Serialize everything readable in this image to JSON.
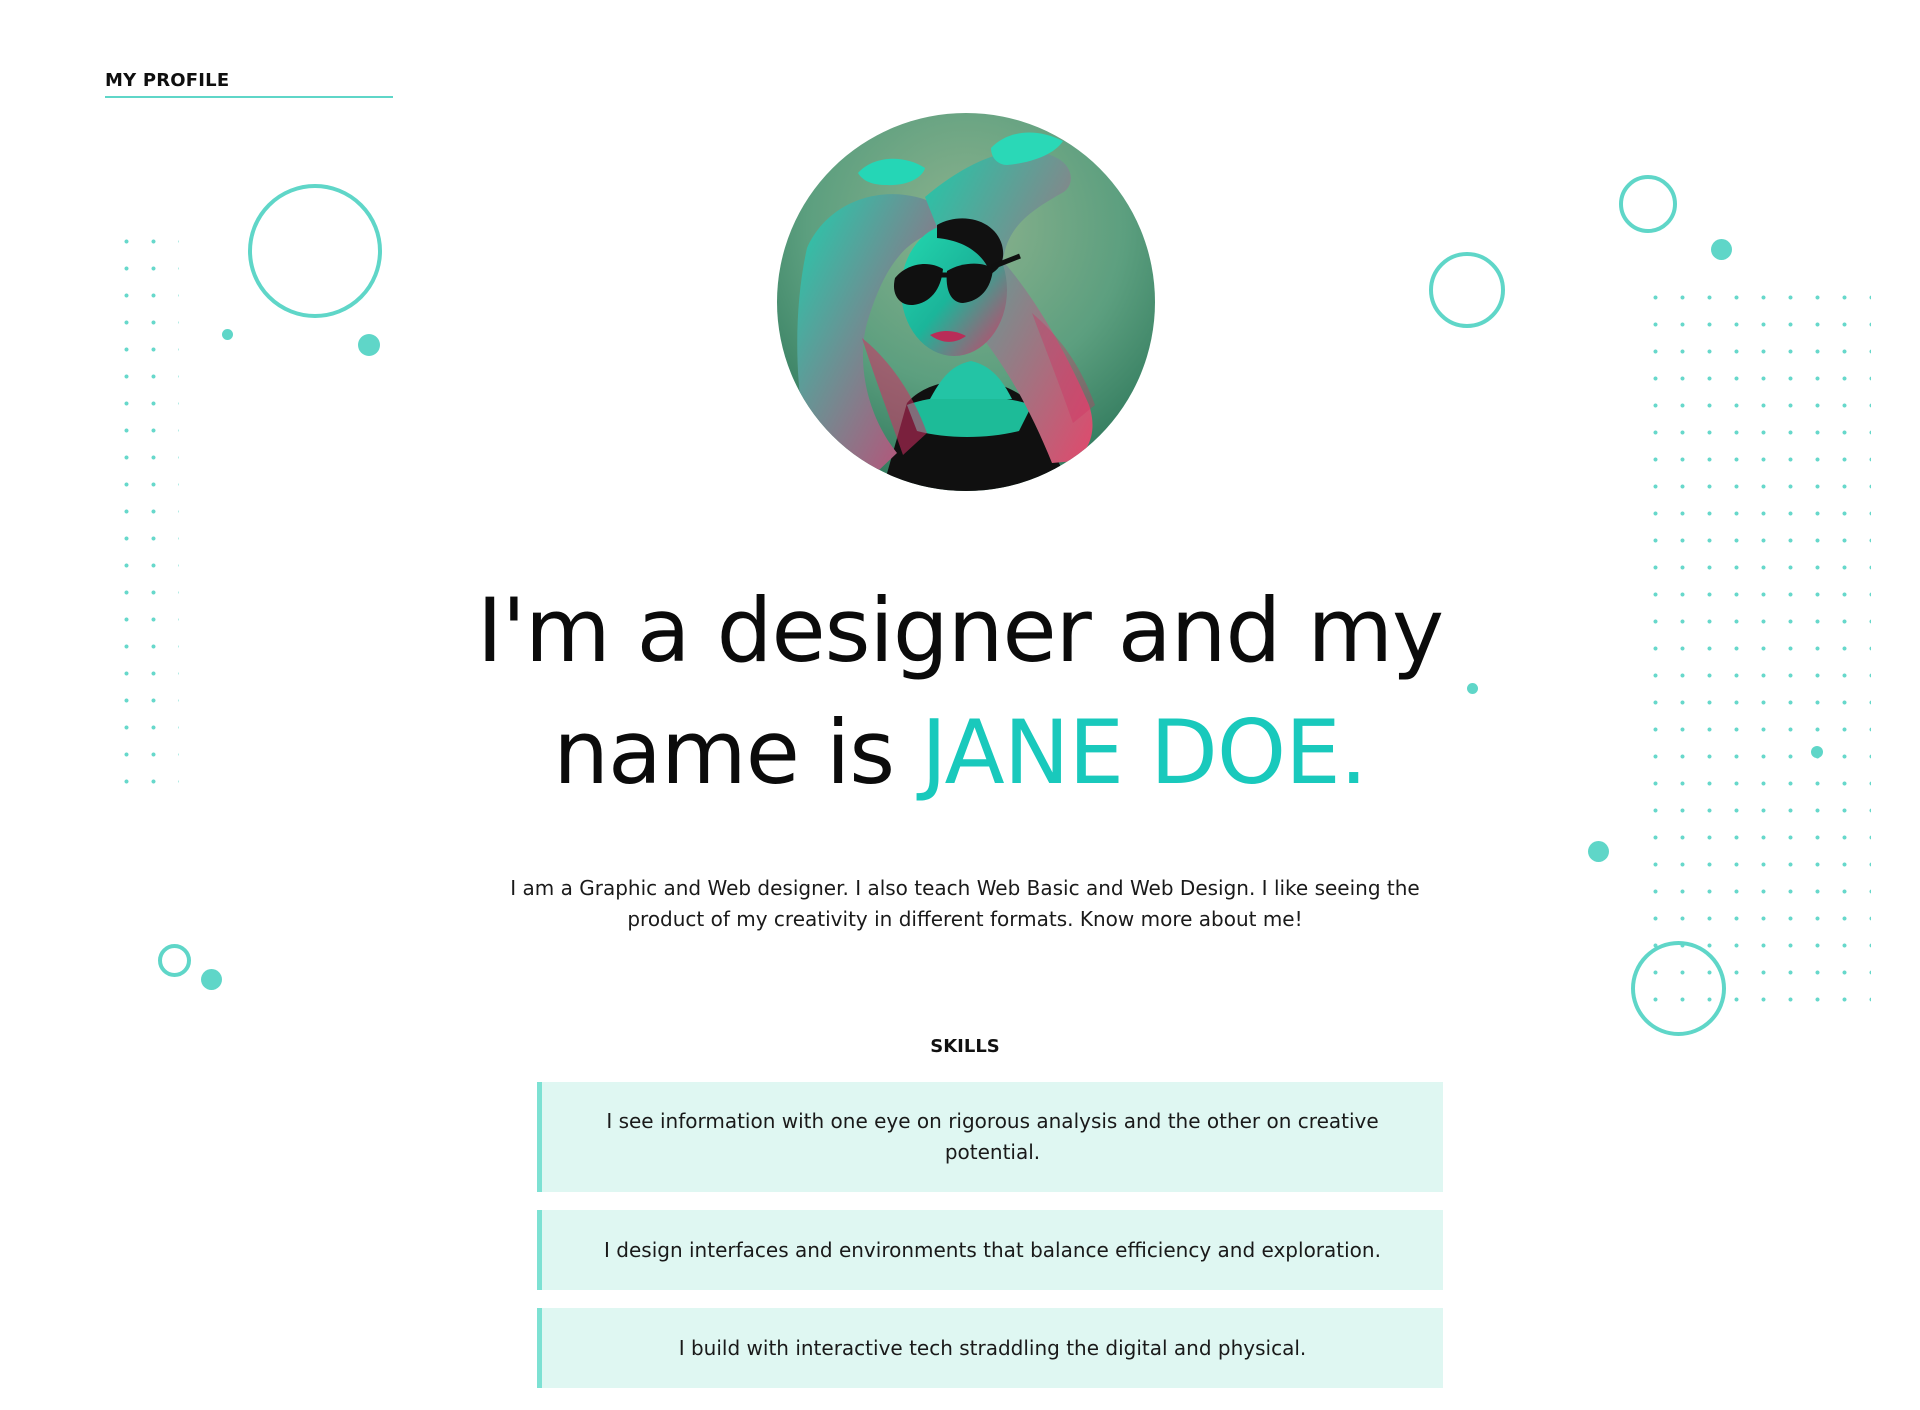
{
  "header": {
    "title": "MY PROFILE"
  },
  "hero": {
    "avatar_label": "profile-photo",
    "headline_line1": "I'm a designer and my",
    "headline_prefix": "name is ",
    "headline_name": "JANE DOE.",
    "intro": "I am a Graphic and Web designer. I also teach Web Basic and Web Design. I like seeing the product of my creativity in different formats. Know more about me!"
  },
  "skills": {
    "title": "SKILLS",
    "items": [
      "I see information with one eye on rigorous analysis and the other on creative potential.",
      "I design interfaces and environments that balance efficiency and exploration.",
      "I build with interactive tech straddling the digital and physical."
    ]
  },
  "colors": {
    "accent": "#5fd6c8",
    "accent_strong": "#19c9bc",
    "card_bg": "#dff7f2"
  },
  "icons": {
    "avatar": "portrait-icon"
  }
}
